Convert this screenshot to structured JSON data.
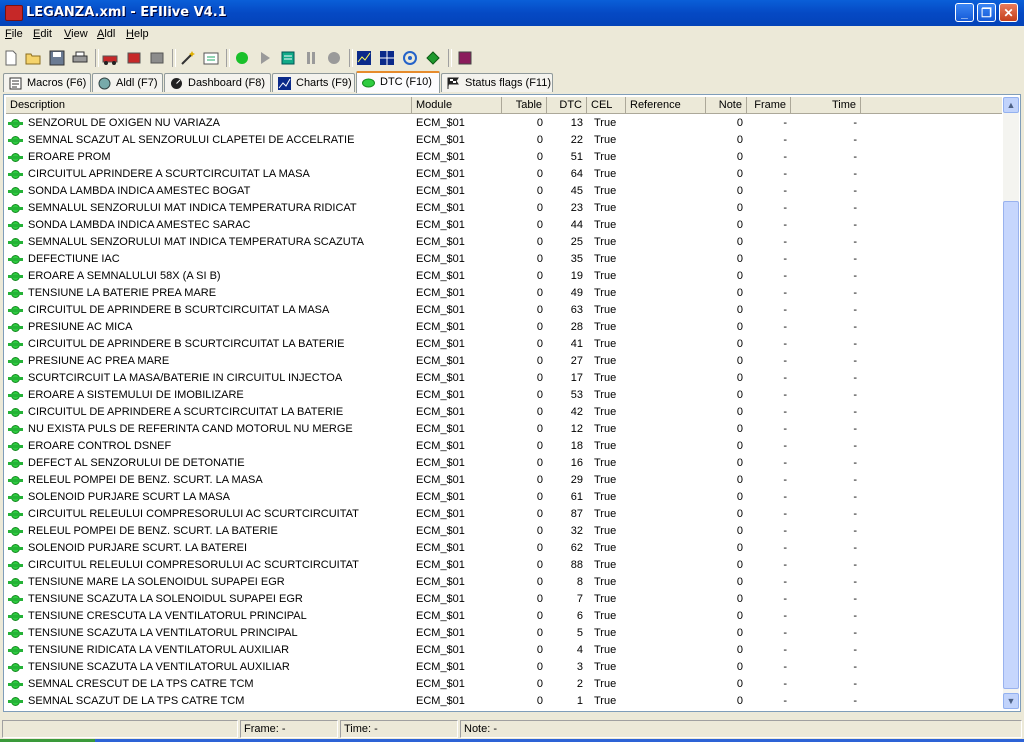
{
  "window": {
    "title": "LEGANZA.xml - EFIlive V4.1"
  },
  "menu": [
    "File",
    "Edit",
    "View",
    "Aldl",
    "Help"
  ],
  "tabs": [
    {
      "label": "Macros (F6)",
      "icon": "macro-icon"
    },
    {
      "label": "Aldl (F7)",
      "icon": "aldl-icon"
    },
    {
      "label": "Dashboard (F8)",
      "icon": "dashboard-icon"
    },
    {
      "label": "Charts (F9)",
      "icon": "chart-icon"
    },
    {
      "label": "DTC (F10)",
      "icon": "dtc-icon",
      "active": true
    },
    {
      "label": "Status flags (F11)",
      "icon": "flag-icon"
    }
  ],
  "columns": [
    "Description",
    "Module",
    "Table",
    "DTC",
    "CEL",
    "Reference",
    "Note",
    "Frame",
    "Time"
  ],
  "rows": [
    [
      "SENZORUL DE OXIGEN NU VARIAZA",
      "ECM_$01",
      "0",
      "13",
      "True",
      "",
      "0",
      "-",
      "-"
    ],
    [
      "SEMNAL SCAZUT AL SENZORULUI CLAPETEI DE ACCELRATIE",
      "ECM_$01",
      "0",
      "22",
      "True",
      "",
      "0",
      "-",
      "-"
    ],
    [
      "EROARE PROM",
      "ECM_$01",
      "0",
      "51",
      "True",
      "",
      "0",
      "-",
      "-"
    ],
    [
      "CIRCUITUL APRINDERE A SCURTCIRCUITAT LA MASA",
      "ECM_$01",
      "0",
      "64",
      "True",
      "",
      "0",
      "-",
      "-"
    ],
    [
      "SONDA LAMBDA INDICA AMESTEC BOGAT",
      "ECM_$01",
      "0",
      "45",
      "True",
      "",
      "0",
      "-",
      "-"
    ],
    [
      "SEMNALUL SENZORULUI MAT INDICA TEMPERATURA RIDICAT",
      "ECM_$01",
      "0",
      "23",
      "True",
      "",
      "0",
      "-",
      "-"
    ],
    [
      "SONDA LAMBDA INDICA AMESTEC SARAC",
      "ECM_$01",
      "0",
      "44",
      "True",
      "",
      "0",
      "-",
      "-"
    ],
    [
      "SEMNALUL SENZORULUI MAT INDICA TEMPERATURA SCAZUTA",
      "ECM_$01",
      "0",
      "25",
      "True",
      "",
      "0",
      "-",
      "-"
    ],
    [
      "DEFECTIUNE IAC",
      "ECM_$01",
      "0",
      "35",
      "True",
      "",
      "0",
      "-",
      "-"
    ],
    [
      "EROARE A SEMNALULUI 58X (A SI B)",
      "ECM_$01",
      "0",
      "19",
      "True",
      "",
      "0",
      "-",
      "-"
    ],
    [
      "TENSIUNE LA BATERIE PREA MARE",
      "ECM_$01",
      "0",
      "49",
      "True",
      "",
      "0",
      "-",
      "-"
    ],
    [
      "CIRCUITUL DE APRINDERE B SCURTCIRCUITAT LA MASA",
      "ECM_$01",
      "0",
      "63",
      "True",
      "",
      "0",
      "-",
      "-"
    ],
    [
      "PRESIUNE AC MICA",
      "ECM_$01",
      "0",
      "28",
      "True",
      "",
      "0",
      "-",
      "-"
    ],
    [
      "CIRCUITUL DE APRINDERE B SCURTCIRCUITAT LA BATERIE",
      "ECM_$01",
      "0",
      "41",
      "True",
      "",
      "0",
      "-",
      "-"
    ],
    [
      "PRESIUNE AC PREA MARE",
      "ECM_$01",
      "0",
      "27",
      "True",
      "",
      "0",
      "-",
      "-"
    ],
    [
      "SCURTCIRCUIT LA MASA/BATERIE IN CIRCUITUL INJECTOA",
      "ECM_$01",
      "0",
      "17",
      "True",
      "",
      "0",
      "-",
      "-"
    ],
    [
      "EROARE A SISTEMULUI DE IMOBILIZARE",
      "ECM_$01",
      "0",
      "53",
      "True",
      "",
      "0",
      "-",
      "-"
    ],
    [
      "CIRCUITUL DE APRINDERE A SCURTCIRCUITAT LA BATERIE",
      "ECM_$01",
      "0",
      "42",
      "True",
      "",
      "0",
      "-",
      "-"
    ],
    [
      "NU EXISTA PULS DE REFERINTA CAND MOTORUL NU MERGE",
      "ECM_$01",
      "0",
      "12",
      "True",
      "",
      "0",
      "-",
      "-"
    ],
    [
      "EROARE CONTROL DSNEF",
      "ECM_$01",
      "0",
      "18",
      "True",
      "",
      "0",
      "-",
      "-"
    ],
    [
      "DEFECT AL SENZORULUI DE DETONATIE",
      "ECM_$01",
      "0",
      "16",
      "True",
      "",
      "0",
      "-",
      "-"
    ],
    [
      "RELEUL POMPEI DE BENZ. SCURT. LA MASA",
      "ECM_$01",
      "0",
      "29",
      "True",
      "",
      "0",
      "-",
      "-"
    ],
    [
      "SOLENOID PURJARE SCURT LA MASA",
      "ECM_$01",
      "0",
      "61",
      "True",
      "",
      "0",
      "-",
      "-"
    ],
    [
      "CIRCUITUL RELEULUI COMPRESORULUI AC SCURTCIRCUITAT",
      "ECM_$01",
      "0",
      "87",
      "True",
      "",
      "0",
      "-",
      "-"
    ],
    [
      "RELEUL POMPEI DE BENZ. SCURT. LA BATERIE",
      "ECM_$01",
      "0",
      "32",
      "True",
      "",
      "0",
      "-",
      "-"
    ],
    [
      "SOLENOID PURJARE SCURT. LA BATEREI",
      "ECM_$01",
      "0",
      "62",
      "True",
      "",
      "0",
      "-",
      "-"
    ],
    [
      "CIRCUITUL RELEULUI COMPRESORULUI AC SCURTCIRCUITAT",
      "ECM_$01",
      "0",
      "88",
      "True",
      "",
      "0",
      "-",
      "-"
    ],
    [
      "TENSIUNE MARE LA SOLENOIDUL SUPAPEI EGR",
      "ECM_$01",
      "0",
      "8",
      "True",
      "",
      "0",
      "-",
      "-"
    ],
    [
      "TENSIUNE SCAZUTA LA SOLENOIDUL SUPAPEI EGR",
      "ECM_$01",
      "0",
      "7",
      "True",
      "",
      "0",
      "-",
      "-"
    ],
    [
      "TENSIUNE CRESCUTA LA VENTILATORUL PRINCIPAL",
      "ECM_$01",
      "0",
      "6",
      "True",
      "",
      "0",
      "-",
      "-"
    ],
    [
      "TENSIUNE SCAZUTA LA VENTILATORUL PRINCIPAL",
      "ECM_$01",
      "0",
      "5",
      "True",
      "",
      "0",
      "-",
      "-"
    ],
    [
      "TENSIUNE RIDICATA  LA VENTILATORUL AUXILIAR",
      "ECM_$01",
      "0",
      "4",
      "True",
      "",
      "0",
      "-",
      "-"
    ],
    [
      "TENSIUNE SCAZUTA LA VENTILATORUL AUXILIAR",
      "ECM_$01",
      "0",
      "3",
      "True",
      "",
      "0",
      "-",
      "-"
    ],
    [
      "SEMNAL CRESCUT DE LA TPS CATRE TCM",
      "ECM_$01",
      "0",
      "2",
      "True",
      "",
      "0",
      "-",
      "-"
    ],
    [
      "SEMNAL SCAZUT DE LA TPS CATRE TCM",
      "ECM_$01",
      "0",
      "1",
      "True",
      "",
      "0",
      "-",
      "-"
    ]
  ],
  "status": {
    "frame": "Frame: -",
    "time": "Time: -",
    "note": "Note: -"
  },
  "toolbar_icons": [
    "new-file-icon",
    "open-folder-icon",
    "save-icon",
    "print-icon",
    "sep",
    "vehicle-icon",
    "load-icon",
    "store-icon",
    "sep",
    "wizard-icon",
    "options-icon",
    "sep",
    "start-icon",
    "play-icon",
    "record-icon",
    "pause-icon",
    "stop-icon",
    "sep",
    "chart-view-icon",
    "grid-view-icon",
    "target-icon",
    "green-diamond-icon",
    "sep",
    "book-icon"
  ],
  "colors": {
    "titlebar": "#0549c4",
    "dtc_indicator": "#2ecc40",
    "active_tab_accent": "#e68b2c"
  }
}
